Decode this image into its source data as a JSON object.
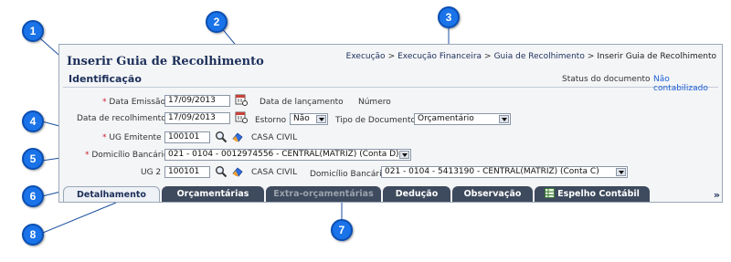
{
  "header": {
    "title": "Inserir Guia de Recolhimento",
    "breadcrumb": [
      "Execução",
      "Execução Financeira",
      "Guia de Recolhimento",
      "Inserir Guia de Recolhimento"
    ],
    "separator": ">"
  },
  "section": {
    "title": "Identificação",
    "status_label": "Status do documento",
    "status_value": "Não contabilizado"
  },
  "form": {
    "data_emissao": {
      "required_mark": "*",
      "label": "Data Emissão",
      "value": "17/09/2013"
    },
    "data_lancamento": {
      "label": "Data de lançamento"
    },
    "numero": {
      "label": "Número"
    },
    "data_recolhimento": {
      "label": "Data de recolhimento",
      "value": "17/09/2013"
    },
    "estorno": {
      "label": "Estorno",
      "value": "Não"
    },
    "tipo_documento": {
      "label": "Tipo de Documento",
      "value": "Orçamentário"
    },
    "ug_emitente": {
      "required_mark": "*",
      "label": "UG Emitente",
      "value": "100101",
      "name": "CASA CIVIL"
    },
    "domicilio_bancario": {
      "required_mark": "*",
      "label": "Domicílio Bancário",
      "value": "021 - 0104 - 0012974556 - CENTRAL(MATRIZ) (Conta D)"
    },
    "ug2": {
      "label": "UG 2",
      "value": "100101",
      "name": "CASA CIVIL"
    },
    "domicilio_bancario_2": {
      "label": "Domicílio Bancário",
      "value": "021 - 0104 - 5413190 - CENTRAL(MATRIZ) (Conta C)"
    }
  },
  "tabs": [
    {
      "label": "Detalhamento"
    },
    {
      "label": "Orçamentárias"
    },
    {
      "label": "Extra-orçamentárias"
    },
    {
      "label": "Dedução"
    },
    {
      "label": "Observação"
    },
    {
      "label": "Espelho Contábil"
    }
  ],
  "more_glyph": "»",
  "callouts": [
    "1",
    "2",
    "3",
    "4",
    "5",
    "6",
    "7",
    "8"
  ],
  "icons": {
    "calendar": "calendar-icon",
    "search": "search-icon",
    "eraser": "eraser-icon",
    "spreadsheet": "spreadsheet-icon"
  },
  "colors": {
    "callout": "#1a73e8",
    "title": "#1c2f5a",
    "tab_dark": "#3e4a5d",
    "status_value": "#1a5fd6"
  }
}
